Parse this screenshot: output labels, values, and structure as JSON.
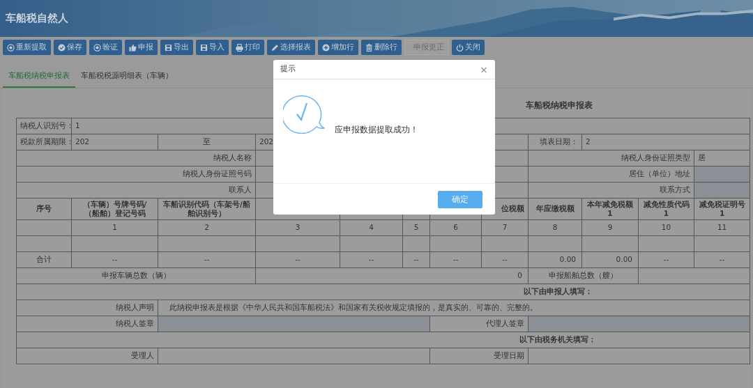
{
  "app": {
    "title": "车船税自然人"
  },
  "toolbar": [
    {
      "label": "重新提取",
      "disabled": false
    },
    {
      "label": "保存",
      "disabled": false
    },
    {
      "label": "验证",
      "disabled": false
    },
    {
      "label": "申报",
      "disabled": false
    },
    {
      "label": "导出",
      "disabled": false
    },
    {
      "label": "导入",
      "disabled": false
    },
    {
      "label": "打印",
      "disabled": false
    },
    {
      "label": "选择报表",
      "disabled": false
    },
    {
      "label": "增加行",
      "disabled": false
    },
    {
      "label": "删除行",
      "disabled": false
    },
    {
      "label": "申报更正",
      "disabled": true
    },
    {
      "label": "关闭",
      "disabled": false
    }
  ],
  "tabs": [
    {
      "label": "车船税纳税申报表",
      "selected": true
    },
    {
      "label": "车船税税源明细表（车辆）",
      "selected": false
    }
  ],
  "form": {
    "title": "车船税纳税申报表",
    "rows": [
      {
        "cells": [
          {
            "kind": "label-left",
            "text": "纳税人识别号："
          },
          {
            "kind": "value",
            "text": "1",
            "colspan": 11
          }
        ]
      },
      {
        "cells": [
          {
            "kind": "label-left",
            "text": "税款所属期限："
          },
          {
            "kind": "value",
            "text": "202"
          },
          {
            "kind": "center",
            "text": "至"
          },
          {
            "kind": "value",
            "text": "202",
            "colspan": 5
          },
          {
            "kind": "label",
            "text": "填表日期："
          },
          {
            "kind": "value",
            "text": "2",
            "colspan": 3
          }
        ]
      },
      {
        "cells": [
          {
            "kind": "label",
            "text": "纳税人名称",
            "colspan": 3
          },
          {
            "kind": "blank",
            "colspan": 5
          },
          {
            "kind": "label",
            "text": "纳税人身份证照类型",
            "colspan": 3
          },
          {
            "kind": "value",
            "text": "居"
          }
        ]
      },
      {
        "cells": [
          {
            "kind": "label",
            "text": "纳税人身份证照号码",
            "colspan": 3
          },
          {
            "kind": "blank",
            "colspan": 5
          },
          {
            "kind": "label",
            "text": "居住（单位）地址",
            "colspan": 3
          },
          {
            "kind": "input"
          }
        ]
      },
      {
        "cells": [
          {
            "kind": "label",
            "text": "联系人",
            "colspan": 3
          },
          {
            "kind": "blank",
            "colspan": 5
          },
          {
            "kind": "label",
            "text": "联系方式",
            "colspan": 3
          },
          {
            "kind": "input"
          }
        ]
      },
      {
        "cells": [
          {
            "kind": "head",
            "text": "序号"
          },
          {
            "kind": "head",
            "text": "（车辆）号牌号码/（船舶）登记号码"
          },
          {
            "kind": "head",
            "text": "车船识别代码（车架号/船舶识别号）"
          },
          {
            "kind": "blank"
          },
          {
            "kind": "blank"
          },
          {
            "kind": "blank"
          },
          {
            "kind": "blank"
          },
          {
            "kind": "head-right",
            "text": "位税额"
          },
          {
            "kind": "head",
            "text": "年应缴税额"
          },
          {
            "kind": "head",
            "text": "本年减免税额",
            "sub": "1"
          },
          {
            "kind": "head",
            "text": "减免性质代码",
            "sub": "1"
          },
          {
            "kind": "head",
            "text": "减免税证明号",
            "sub": "1"
          }
        ]
      },
      {
        "cells": [
          {
            "kind": "blank"
          },
          {
            "kind": "center",
            "text": "1"
          },
          {
            "kind": "center",
            "text": "2"
          },
          {
            "kind": "center",
            "text": "3"
          },
          {
            "kind": "center",
            "text": "4"
          },
          {
            "kind": "center",
            "text": "5"
          },
          {
            "kind": "center",
            "text": "6"
          },
          {
            "kind": "center",
            "text": "7"
          },
          {
            "kind": "center",
            "text": "8"
          },
          {
            "kind": "center",
            "text": "9"
          },
          {
            "kind": "center",
            "text": "10"
          },
          {
            "kind": "center",
            "text": "11"
          }
        ]
      },
      {
        "cells": [
          {
            "kind": "blank"
          },
          {
            "kind": "blank"
          },
          {
            "kind": "blank"
          },
          {
            "kind": "blank"
          },
          {
            "kind": "blank"
          },
          {
            "kind": "blank"
          },
          {
            "kind": "blank"
          },
          {
            "kind": "blank"
          },
          {
            "kind": "blank"
          },
          {
            "kind": "blank"
          },
          {
            "kind": "blank"
          },
          {
            "kind": "blank"
          }
        ]
      },
      {
        "cells": [
          {
            "kind": "center",
            "text": "合计"
          },
          {
            "kind": "center",
            "text": "--"
          },
          {
            "kind": "center",
            "text": "--"
          },
          {
            "kind": "center",
            "text": "--"
          },
          {
            "kind": "center",
            "text": "--"
          },
          {
            "kind": "center",
            "text": "--"
          },
          {
            "kind": "center",
            "text": "--"
          },
          {
            "kind": "center",
            "text": "--"
          },
          {
            "kind": "number",
            "text": "0.00"
          },
          {
            "kind": "number",
            "text": "0.00"
          },
          {
            "kind": "center",
            "text": "--"
          },
          {
            "kind": "center",
            "text": "--"
          }
        ]
      },
      {
        "cells": [
          {
            "kind": "center",
            "text": "申报车辆总数（辆）",
            "colspan": 3
          },
          {
            "kind": "number",
            "text": "0",
            "colspan": 5
          },
          {
            "kind": "center",
            "text": "申报船舶总数（艘）",
            "colspan": 2
          },
          {
            "kind": "blank",
            "colspan": 2
          }
        ]
      },
      {
        "cells": [
          {
            "kind": "section",
            "text": "以下由申报人填写：",
            "colspan": 12
          }
        ]
      },
      {
        "cells": [
          {
            "kind": "label",
            "text": "纳税人声明",
            "colspan": 2
          },
          {
            "kind": "note",
            "text": "此纳税申报表是根据《中华人民共和国车船税法》和国家有关税收规定填报的，是真实的、可靠的、完整的。",
            "colspan": 10
          }
        ]
      },
      {
        "cells": [
          {
            "kind": "label",
            "text": "纳税人签章",
            "colspan": 2
          },
          {
            "kind": "input",
            "colspan": 4
          },
          {
            "kind": "label",
            "text": "代理人签章",
            "colspan": 2
          },
          {
            "kind": "input",
            "colspan": 4
          }
        ]
      },
      {
        "cells": [
          {
            "kind": "section",
            "text": "以下由税务机关填写：",
            "colspan": 12
          }
        ]
      },
      {
        "cells": [
          {
            "kind": "label",
            "text": "受理人",
            "colspan": 2
          },
          {
            "kind": "blank",
            "colspan": 4
          },
          {
            "kind": "label",
            "text": "受理日期",
            "colspan": 2
          },
          {
            "kind": "blank",
            "colspan": 4
          }
        ]
      }
    ]
  },
  "dialog": {
    "title": "提示",
    "close": "×",
    "message": "应申报数据提取成功！",
    "button": "确定"
  }
}
